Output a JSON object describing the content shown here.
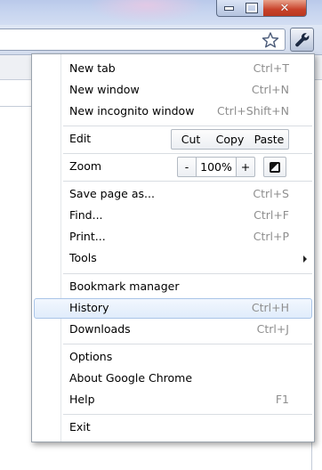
{
  "window": {
    "close_glyph": "✕"
  },
  "toolbar": {
    "bookmark_icon": "star-icon",
    "menu_icon": "wrench-icon"
  },
  "menu": {
    "new_tab": {
      "label": "New tab",
      "shortcut": "Ctrl+T"
    },
    "new_window": {
      "label": "New window",
      "shortcut": "Ctrl+N"
    },
    "new_incognito": {
      "label": "New incognito window",
      "shortcut": "Ctrl+Shift+N"
    },
    "edit": {
      "label": "Edit",
      "cut": "Cut",
      "copy": "Copy",
      "paste": "Paste"
    },
    "zoom": {
      "label": "Zoom",
      "minus": "-",
      "value": "100%",
      "plus": "+"
    },
    "save_page": {
      "label": "Save page as...",
      "shortcut": "Ctrl+S"
    },
    "find": {
      "label": "Find...",
      "shortcut": "Ctrl+F"
    },
    "print": {
      "label": "Print...",
      "shortcut": "Ctrl+P"
    },
    "tools": {
      "label": "Tools"
    },
    "bookmark_manager": {
      "label": "Bookmark manager"
    },
    "history": {
      "label": "History",
      "shortcut": "Ctrl+H"
    },
    "downloads": {
      "label": "Downloads",
      "shortcut": "Ctrl+J"
    },
    "options": {
      "label": "Options"
    },
    "about": {
      "label": "About Google Chrome"
    },
    "help": {
      "label": "Help",
      "shortcut": "F1"
    },
    "exit": {
      "label": "Exit"
    }
  },
  "colors": {
    "highlight_bg": "#e0ecfb",
    "highlight_border": "#a9c4e8",
    "shortcut_text": "#8e8e8e",
    "close_button": "#c8412a"
  }
}
